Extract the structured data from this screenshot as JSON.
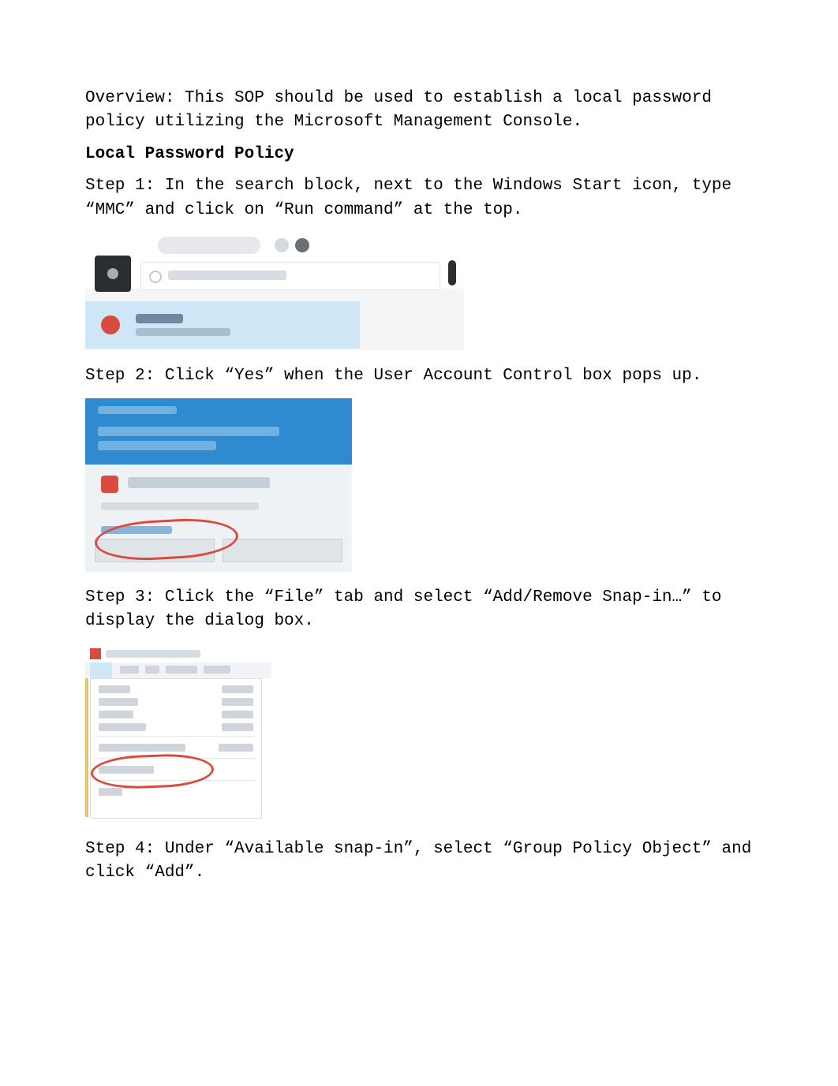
{
  "overview": "Overview:  This SOP should be used to establish a local password policy utilizing the Microsoft Management Console.",
  "heading": "Local Password Policy",
  "step1": "Step 1:  In the search block, next to the Windows Start icon, type “MMC” and click on “Run command” at the top.",
  "step2": "Step 2:  Click “Yes” when the User Account Control box pops up.",
  "step3": "Step 3:  Click the “File” tab and select “Add/Remove Snap-in…” to display the dialog box.",
  "step4": "Step 4:  Under “Available snap-in”, select “Group Policy Object” and click “Add”."
}
